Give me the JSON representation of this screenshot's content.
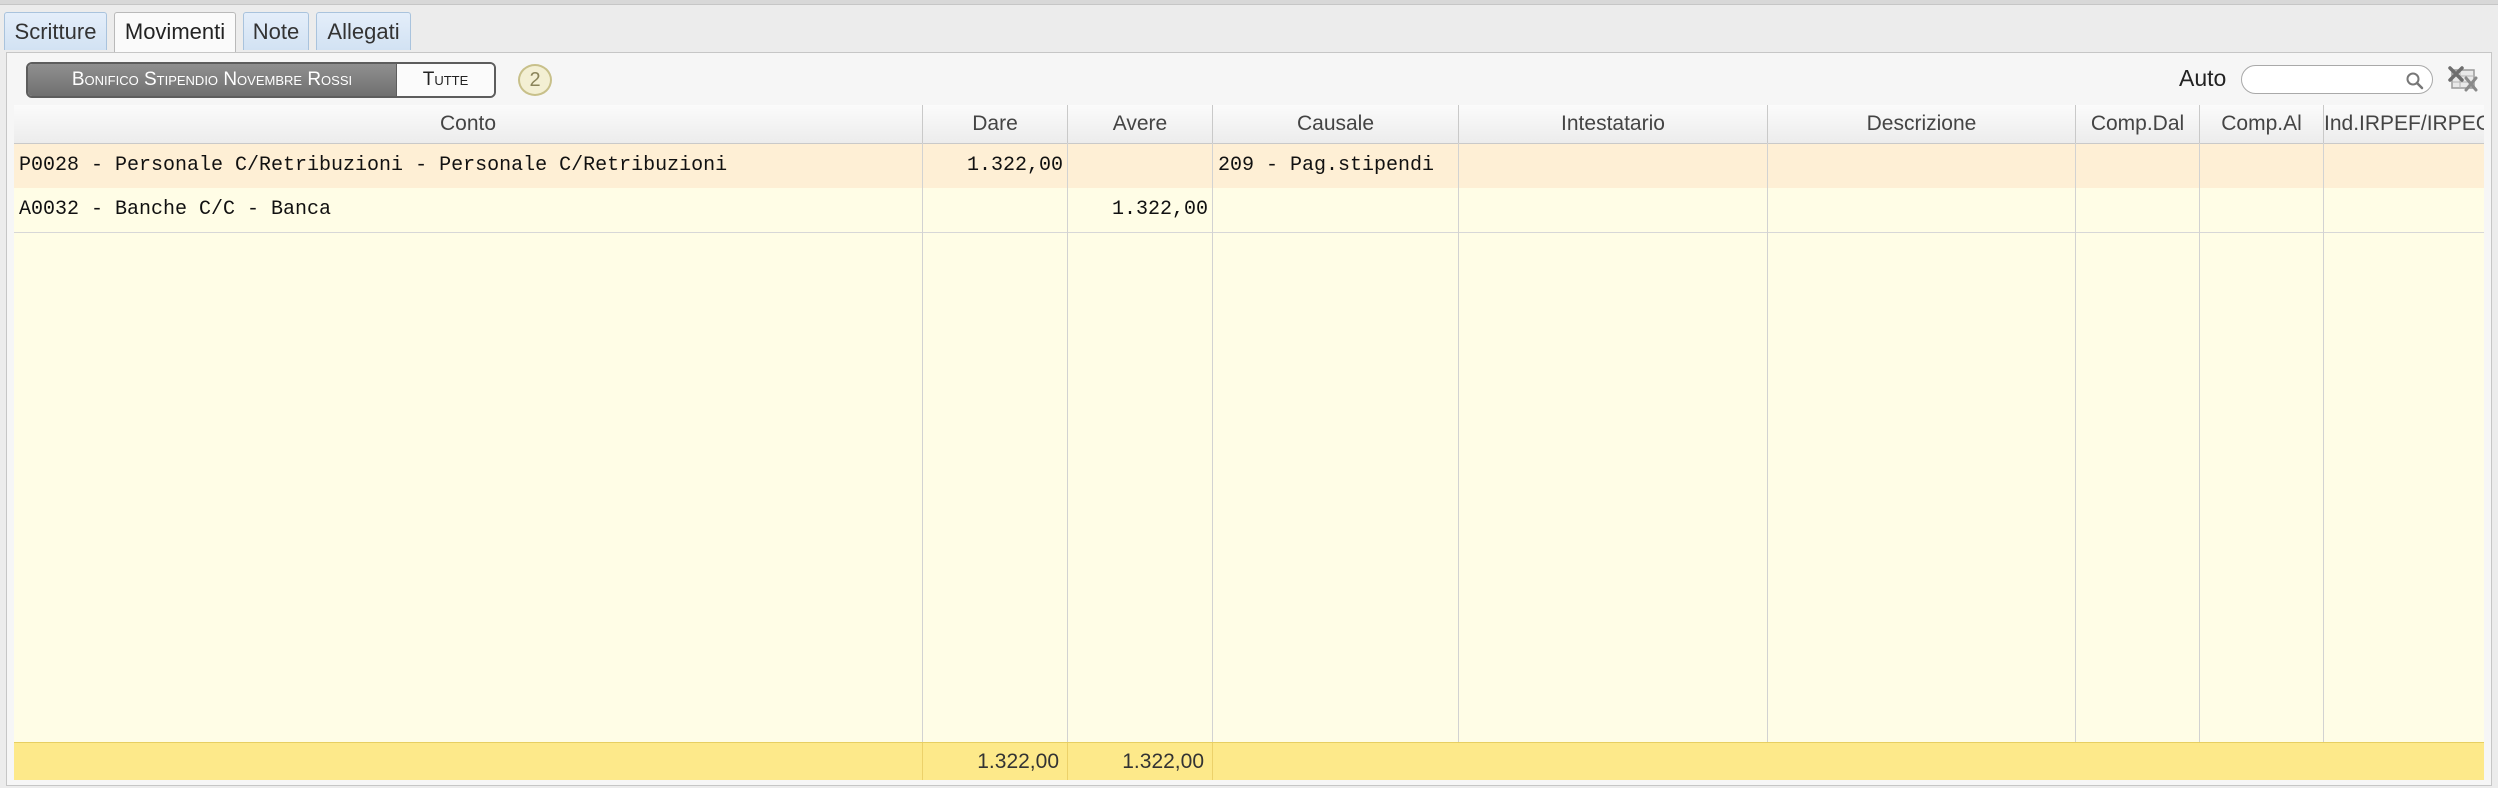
{
  "tabs": [
    "Scritture",
    "Movimenti",
    "Note",
    "Allegati"
  ],
  "active_tab": "Movimenti",
  "filter": {
    "selected_label": "Bonifico Stipendio Novembre Rossi",
    "all_label": "Tutte",
    "count": "2"
  },
  "search": {
    "label": "Auto",
    "value": "",
    "placeholder": ""
  },
  "icons": [
    "search-icon",
    "excel-export-icon"
  ],
  "table": {
    "columns": [
      "Conto",
      "Dare",
      "Avere",
      "Causale",
      "Intestatario",
      "Descrizione",
      "Comp.Dal",
      "Comp.Al",
      "Ind.IRPEF/IRPEG"
    ],
    "rows": [
      {
        "conto": "P0028 - Personale C/Retribuzioni - Personale C/Retribuzioni",
        "dare": "1.322,00",
        "avere": "",
        "causale": "209 - Pag.stipendi",
        "intestatario": "",
        "descrizione": "",
        "comp_dal": "",
        "comp_al": "",
        "ind": ""
      },
      {
        "conto": "A0032 - Banche C/C - Banca",
        "dare": "",
        "avere": "1.322,00",
        "causale": "",
        "intestatario": "",
        "descrizione": "",
        "comp_dal": "",
        "comp_al": "",
        "ind": ""
      }
    ],
    "totals": {
      "dare": "1.322,00",
      "avere": "1.322,00"
    }
  },
  "colors": {
    "selected_row": "#feefd5",
    "grid_background": "#fffde6",
    "totals_background": "#fde98a",
    "tab_background": "#d2e2f3"
  }
}
